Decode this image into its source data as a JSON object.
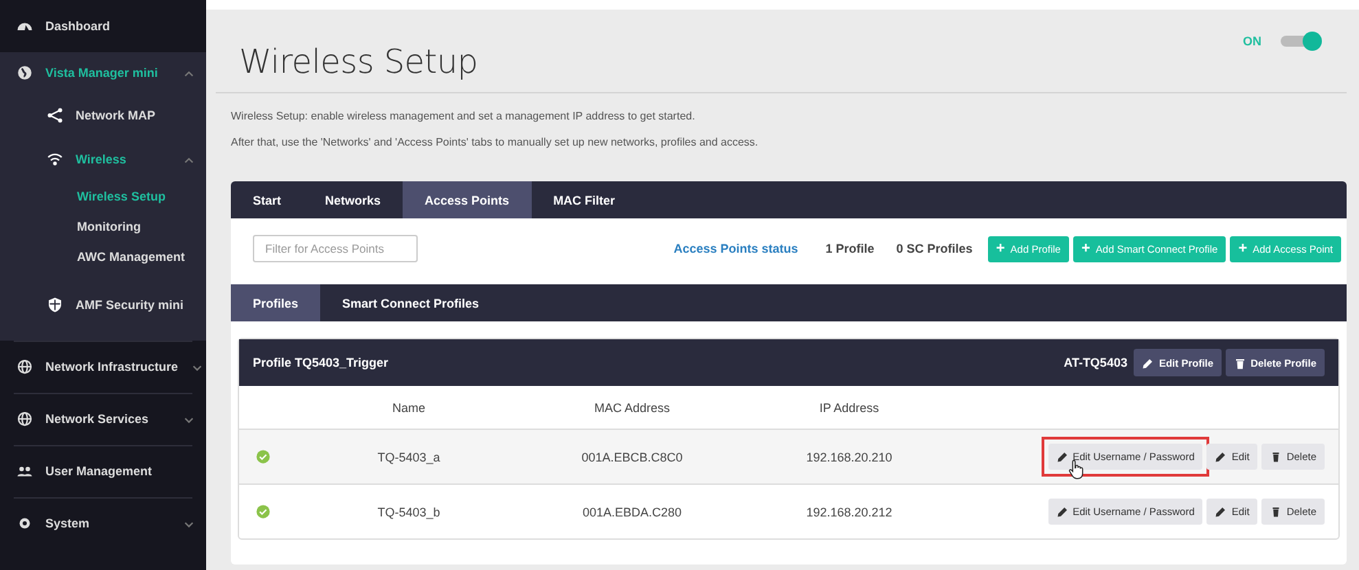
{
  "sidebar": {
    "items": [
      {
        "label": "Dashboard",
        "active": false
      },
      {
        "label": "Vista Manager mini",
        "active": true,
        "expanded": true,
        "children": [
          {
            "label": "Network MAP",
            "active": false
          },
          {
            "label": "Wireless",
            "active": true,
            "expanded": true,
            "children": [
              {
                "label": "Wireless Setup",
                "selected": true
              },
              {
                "label": "Monitoring",
                "selected": false
              },
              {
                "label": "AWC Management",
                "selected": false
              }
            ]
          },
          {
            "label": "AMF Security mini",
            "active": false
          }
        ]
      },
      {
        "label": "Network Infrastructure",
        "active": false,
        "expanded": false
      },
      {
        "label": "Network Services",
        "active": false,
        "expanded": false
      },
      {
        "label": "User Management",
        "active": false
      },
      {
        "label": "System",
        "active": false,
        "expanded": false
      }
    ]
  },
  "page": {
    "title": "Wireless Setup",
    "toggle": {
      "label": "ON",
      "on": true
    },
    "description": [
      "Wireless Setup: enable wireless management and set a management IP address to get started.",
      "After that, use the 'Networks' and 'Access Points' tabs to manually set up new networks, profiles and access."
    ]
  },
  "tabs": [
    {
      "label": "Start",
      "selected": false
    },
    {
      "label": "Networks",
      "selected": false
    },
    {
      "label": "Access Points",
      "selected": true
    },
    {
      "label": "MAC Filter",
      "selected": false
    }
  ],
  "toolbar": {
    "filter": {
      "placeholder": "Filter for Access Points"
    },
    "status_link": "Access Points status",
    "counts": [
      "1 Profile",
      "0 SC Profiles"
    ],
    "buttons": [
      {
        "icon": "+",
        "label": "Add Profile"
      },
      {
        "icon": "+",
        "label": "Add Smart Connect Profile"
      },
      {
        "icon": "+",
        "label": "Add Access Point"
      }
    ]
  },
  "subtabs": [
    {
      "label": "Profiles",
      "selected": true
    },
    {
      "label": "Smart Connect Profiles",
      "selected": false
    }
  ],
  "profile": {
    "title": "Profile TQ5403_Trigger",
    "model": "AT-TQ5403",
    "buttons": [
      {
        "kind": "edit",
        "label": "Edit Profile"
      },
      {
        "kind": "delete",
        "label": "Delete Profile"
      }
    ],
    "columns": [
      "Name",
      "MAC Address",
      "IP Address"
    ],
    "rows": [
      {
        "online": true,
        "name": "TQ-5403_a",
        "mac": "001A.EBCB.C8C0",
        "ip": "192.168.20.210",
        "hovered": true,
        "highlighted": true,
        "actions": [
          {
            "kind": "edit",
            "label": "Edit Username / Password"
          },
          {
            "kind": "edit",
            "label": "Edit"
          },
          {
            "kind": "delete",
            "label": "Delete"
          }
        ]
      },
      {
        "online": true,
        "name": "TQ-5403_b",
        "mac": "001A.EBDA.C280",
        "ip": "192.168.20.212",
        "hovered": false,
        "highlighted": false,
        "actions": [
          {
            "kind": "edit",
            "label": "Edit Username / Password"
          },
          {
            "kind": "edit",
            "label": "Edit"
          },
          {
            "kind": "delete",
            "label": "Delete"
          }
        ]
      }
    ]
  }
}
